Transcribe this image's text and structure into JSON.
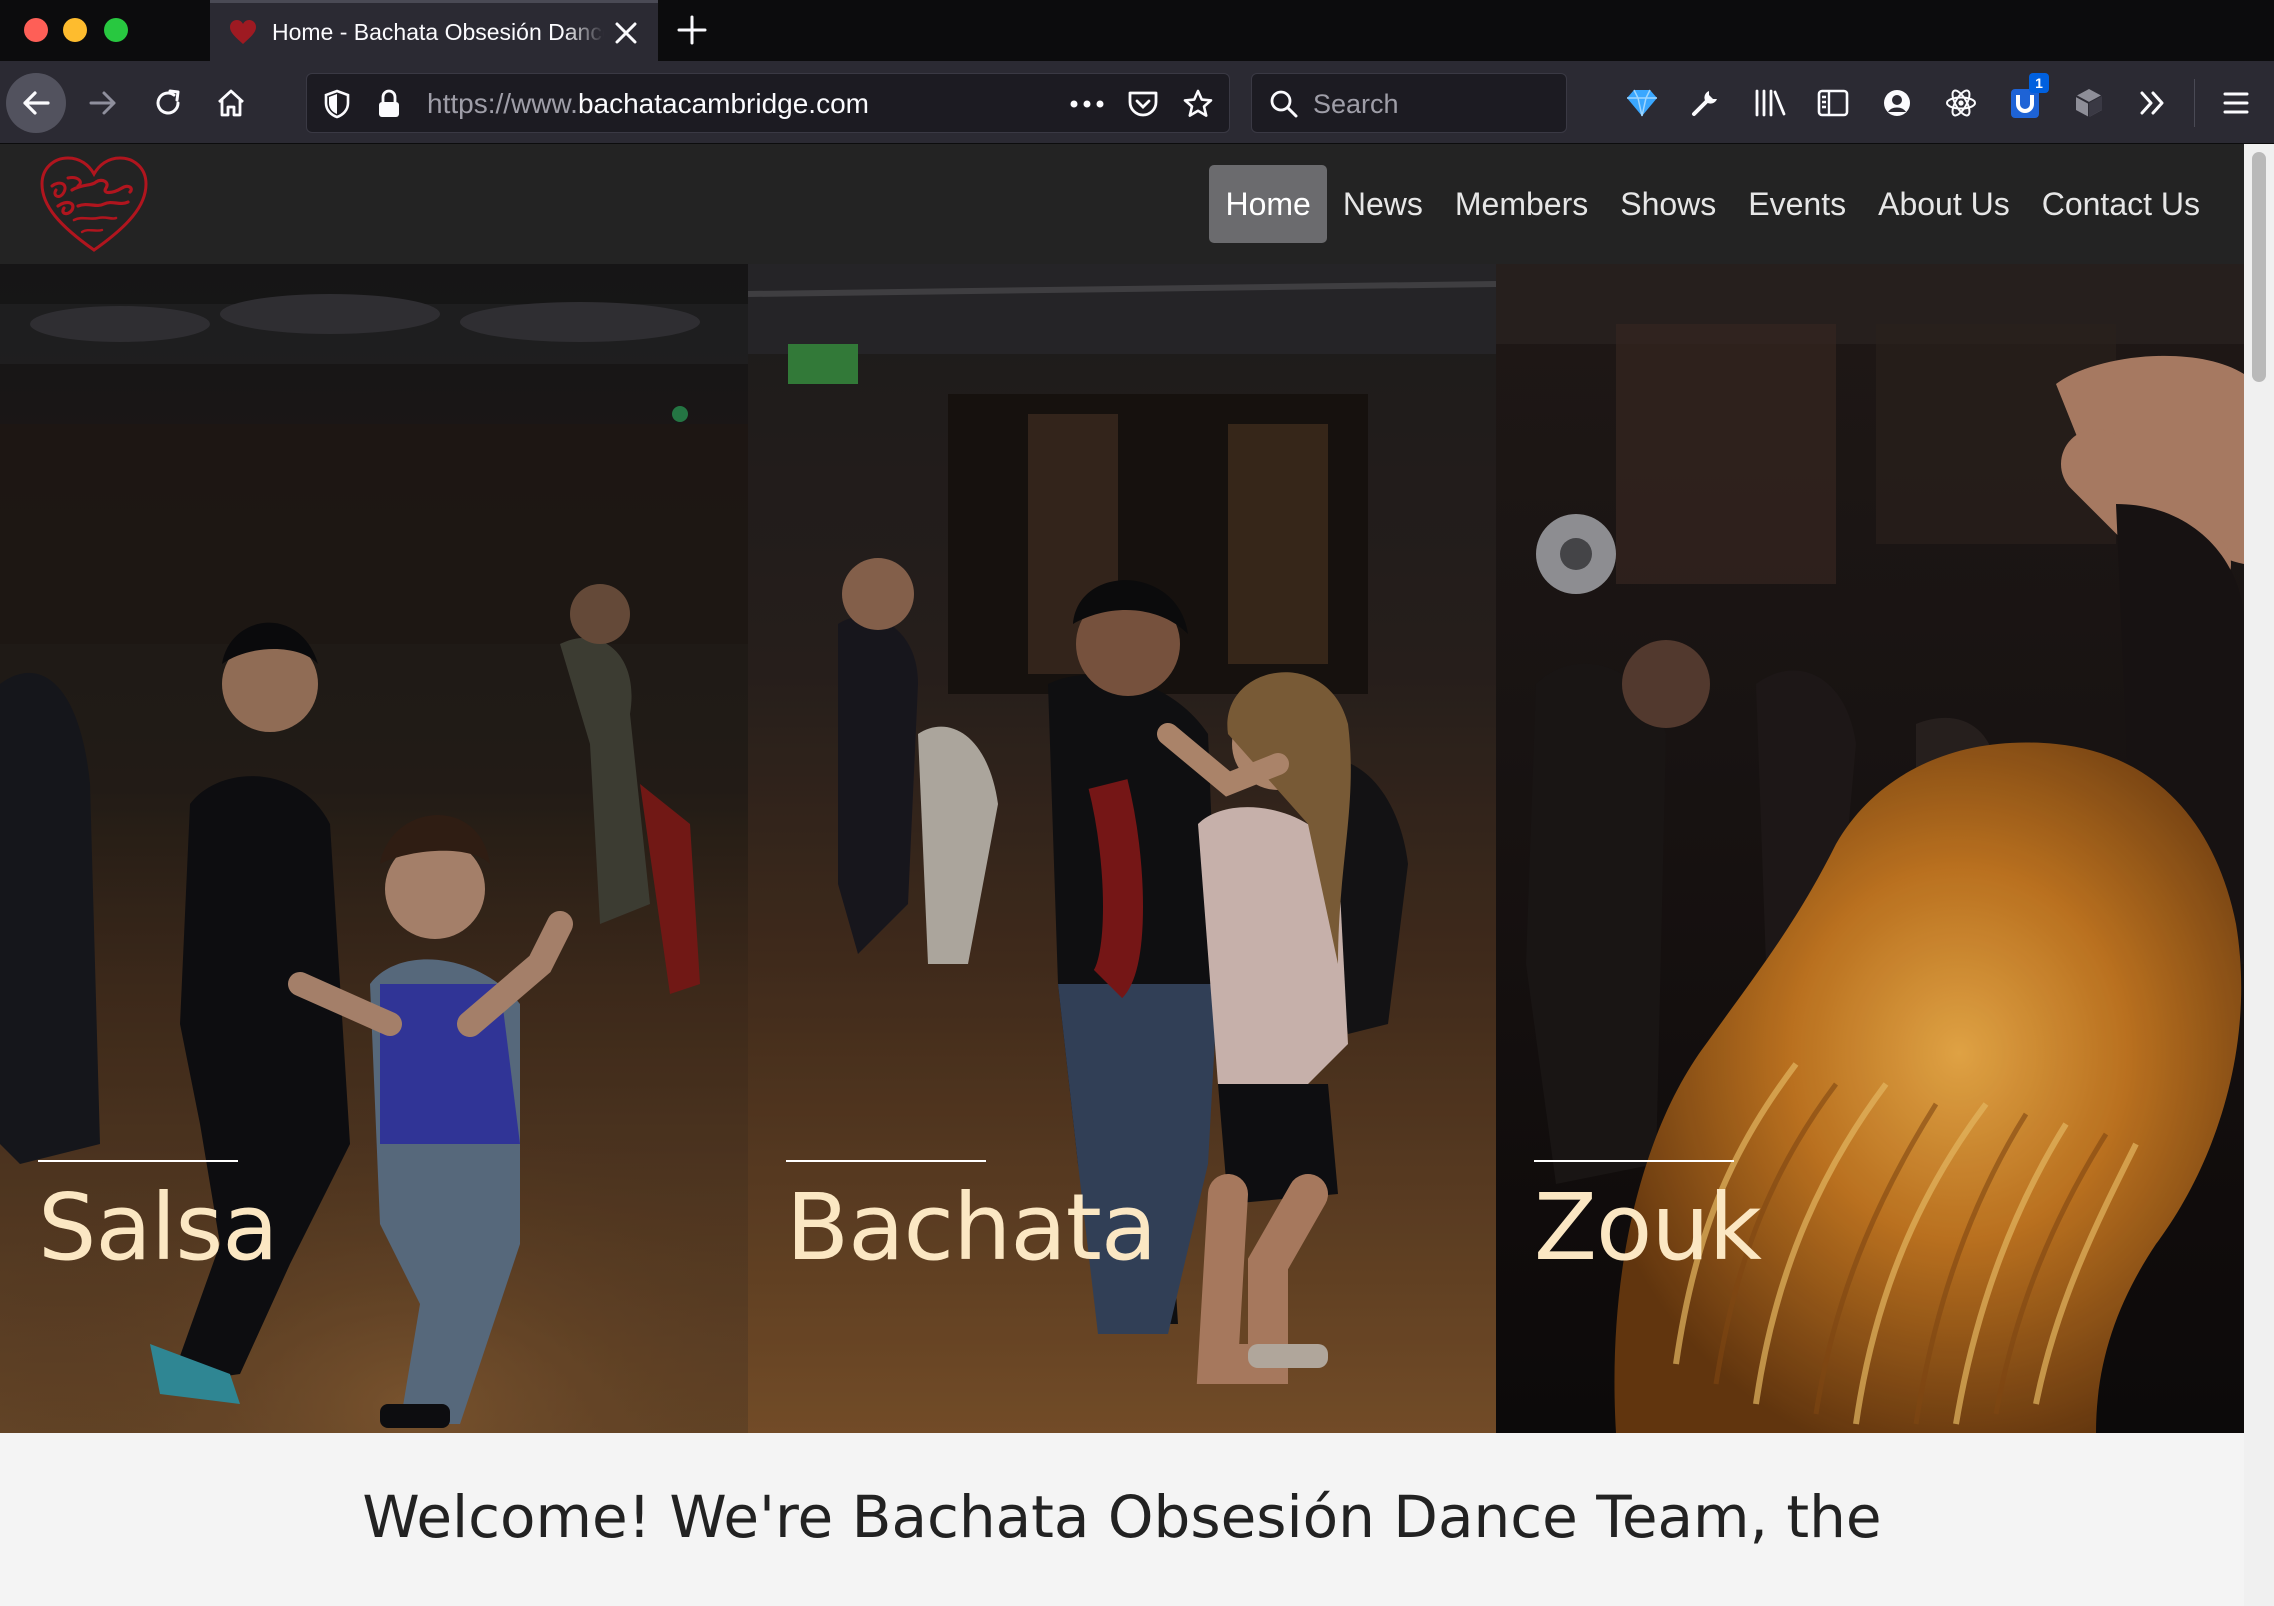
{
  "browser": {
    "tab": {
      "title": "Home - Bachata Obsesión Dance Team"
    },
    "url": {
      "prefix": "https://www.",
      "domain": "bachatacambridge.com"
    },
    "search": {
      "placeholder": "Search"
    },
    "extension_badge": "1",
    "icons": [
      "back-arrow-icon",
      "forward-arrow-icon",
      "reload-icon",
      "home-icon",
      "shield-icon",
      "lock-icon",
      "more-icon",
      "pocket-icon",
      "star-icon",
      "search-icon",
      "diamond-icon",
      "wrench-icon",
      "library-icon",
      "sidebar-icon",
      "account-icon",
      "react-icon",
      "ublock-icon",
      "cube-icon",
      "overflow-chevron-icon",
      "hamburger-menu-icon"
    ]
  },
  "site": {
    "nav": [
      {
        "label": "Home",
        "active": true
      },
      {
        "label": "News"
      },
      {
        "label": "Members"
      },
      {
        "label": "Shows"
      },
      {
        "label": "Events"
      },
      {
        "label": "About Us"
      },
      {
        "label": "Contact Us"
      }
    ],
    "panels": [
      {
        "caption": "Salsa"
      },
      {
        "caption": "Bachata"
      },
      {
        "caption": "Zouk"
      }
    ],
    "welcome": "Welcome! We're Bachata Obsesión Dance Team, the"
  },
  "colors": {
    "header_bg": "#232323",
    "nav_active_bg": "#6b6b6e",
    "caption": "#fbe7c3",
    "logo_red": "#b0151e"
  }
}
